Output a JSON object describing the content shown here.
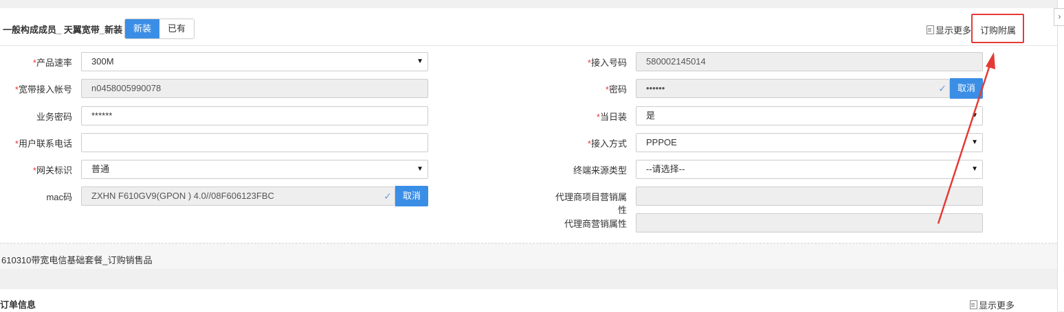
{
  "header": {
    "title": "一般构成成员_ 天翼宽带_新装",
    "seg_new": "新装",
    "seg_existing": "已有",
    "show_more": "显示更多",
    "order_attach": "订购附属"
  },
  "collapse_glyph": "›",
  "left_fields": [
    {
      "label": "产品速率",
      "required": true,
      "value": "300M",
      "type": "select"
    },
    {
      "label": "宽带接入帐号",
      "required": true,
      "value": "n0458005990078",
      "type": "disabled"
    },
    {
      "label": "业务密码",
      "required": false,
      "value": "******",
      "type": "text"
    },
    {
      "label": "用户联系电话",
      "required": true,
      "value": "",
      "type": "text"
    },
    {
      "label": "网关标识",
      "required": true,
      "value": "普通",
      "type": "select"
    },
    {
      "label": "mac码",
      "required": false,
      "value": "ZXHN F610GV9(GPON ) 4.0//08F606123FBC",
      "type": "disabled-cancel",
      "button": "取消"
    }
  ],
  "right_fields": [
    {
      "label": "接入号码",
      "required": true,
      "value": "580002145014",
      "type": "disabled"
    },
    {
      "label": "密码",
      "required": true,
      "value": "••••••",
      "type": "disabled-cancel",
      "button": "取消"
    },
    {
      "label": "当日装",
      "required": true,
      "value": "是",
      "type": "select"
    },
    {
      "label": "接入方式",
      "required": true,
      "value": "PPPOE",
      "type": "select"
    },
    {
      "label": "终端来源类型",
      "required": false,
      "value": "--请选择--",
      "type": "select"
    },
    {
      "label": "代理商项目营销属性",
      "required": false,
      "value": "",
      "type": "disabled"
    },
    {
      "label": "代理商营销属性",
      "required": false,
      "value": "",
      "type": "disabled"
    }
  ],
  "section2": {
    "text": "610310带宽电信基础套餐_订购销售品"
  },
  "section3": {
    "title": "订单信息",
    "show_more": "显示更多"
  },
  "colors": {
    "accent": "#3a8ee6",
    "highlight": "#e53935"
  }
}
